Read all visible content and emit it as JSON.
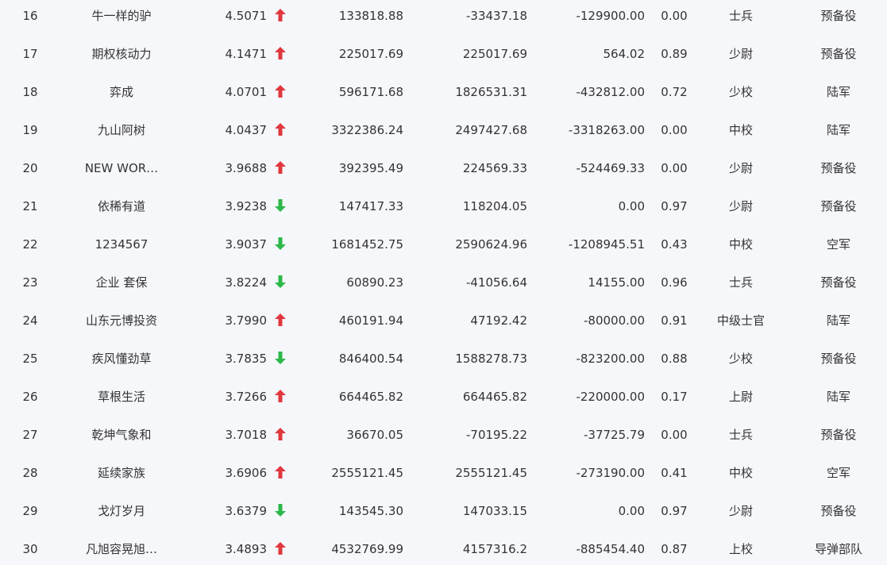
{
  "colors": {
    "up": "#e0383e",
    "down": "#2db84a",
    "background": "#f6f7fb",
    "text": "#333333"
  },
  "rows": [
    {
      "rank": "16",
      "name": "牛一样的驴",
      "score": "4.5071",
      "trend": "up",
      "v1": "133818.88",
      "v2": "-33437.18",
      "v3": "-129900.00",
      "ratio": "0.00",
      "military_rank": "士兵",
      "branch": "预备役"
    },
    {
      "rank": "17",
      "name": "期权核动力",
      "score": "4.1471",
      "trend": "up",
      "v1": "225017.69",
      "v2": "225017.69",
      "v3": "564.02",
      "ratio": "0.89",
      "military_rank": "少尉",
      "branch": "预备役"
    },
    {
      "rank": "18",
      "name": "弈成",
      "score": "4.0701",
      "trend": "up",
      "v1": "596171.68",
      "v2": "1826531.31",
      "v3": "-432812.00",
      "ratio": "0.72",
      "military_rank": "少校",
      "branch": "陆军"
    },
    {
      "rank": "19",
      "name": "九山阿树",
      "score": "4.0437",
      "trend": "up",
      "v1": "3322386.24",
      "v2": "2497427.68",
      "v3": "-3318263.00",
      "ratio": "0.00",
      "military_rank": "中校",
      "branch": "陆军"
    },
    {
      "rank": "20",
      "name": "NEW WOR…",
      "score": "3.9688",
      "trend": "up",
      "v1": "392395.49",
      "v2": "224569.33",
      "v3": "-524469.33",
      "ratio": "0.00",
      "military_rank": "少尉",
      "branch": "预备役"
    },
    {
      "rank": "21",
      "name": "依稀有道",
      "score": "3.9238",
      "trend": "down",
      "v1": "147417.33",
      "v2": "118204.05",
      "v3": "0.00",
      "ratio": "0.97",
      "military_rank": "少尉",
      "branch": "预备役"
    },
    {
      "rank": "22",
      "name": "1234567",
      "score": "3.9037",
      "trend": "down",
      "v1": "1681452.75",
      "v2": "2590624.96",
      "v3": "-1208945.51",
      "ratio": "0.43",
      "military_rank": "中校",
      "branch": "空军"
    },
    {
      "rank": "23",
      "name": "企业 套保",
      "score": "3.8224",
      "trend": "down",
      "v1": "60890.23",
      "v2": "-41056.64",
      "v3": "14155.00",
      "ratio": "0.96",
      "military_rank": "士兵",
      "branch": "预备役"
    },
    {
      "rank": "24",
      "name": "山东元博投资",
      "score": "3.7990",
      "trend": "up",
      "v1": "460191.94",
      "v2": "47192.42",
      "v3": "-80000.00",
      "ratio": "0.91",
      "military_rank": "中级士官",
      "branch": "陆军"
    },
    {
      "rank": "25",
      "name": "疾风懂劲草",
      "score": "3.7835",
      "trend": "down",
      "v1": "846400.54",
      "v2": "1588278.73",
      "v3": "-823200.00",
      "ratio": "0.88",
      "military_rank": "少校",
      "branch": "预备役"
    },
    {
      "rank": "26",
      "name": "草根生活",
      "score": "3.7266",
      "trend": "up",
      "v1": "664465.82",
      "v2": "664465.82",
      "v3": "-220000.00",
      "ratio": "0.17",
      "military_rank": "上尉",
      "branch": "陆军"
    },
    {
      "rank": "27",
      "name": "乾坤气象和",
      "score": "3.7018",
      "trend": "up",
      "v1": "36670.05",
      "v2": "-70195.22",
      "v3": "-37725.79",
      "ratio": "0.00",
      "military_rank": "士兵",
      "branch": "预备役"
    },
    {
      "rank": "28",
      "name": "延续家族",
      "score": "3.6906",
      "trend": "up",
      "v1": "2555121.45",
      "v2": "2555121.45",
      "v3": "-273190.00",
      "ratio": "0.41",
      "military_rank": "中校",
      "branch": "空军"
    },
    {
      "rank": "29",
      "name": "戈灯岁月",
      "score": "3.6379",
      "trend": "down",
      "v1": "143545.30",
      "v2": "147033.15",
      "v3": "0.00",
      "ratio": "0.97",
      "military_rank": "少尉",
      "branch": "预备役"
    },
    {
      "rank": "30",
      "name": "凡旭容晃旭…",
      "score": "3.4893",
      "trend": "up",
      "v1": "4532769.99",
      "v2": "4157316.2",
      "v3": "-885454.40",
      "ratio": "0.87",
      "military_rank": "上校",
      "branch": "导弹部队"
    }
  ]
}
